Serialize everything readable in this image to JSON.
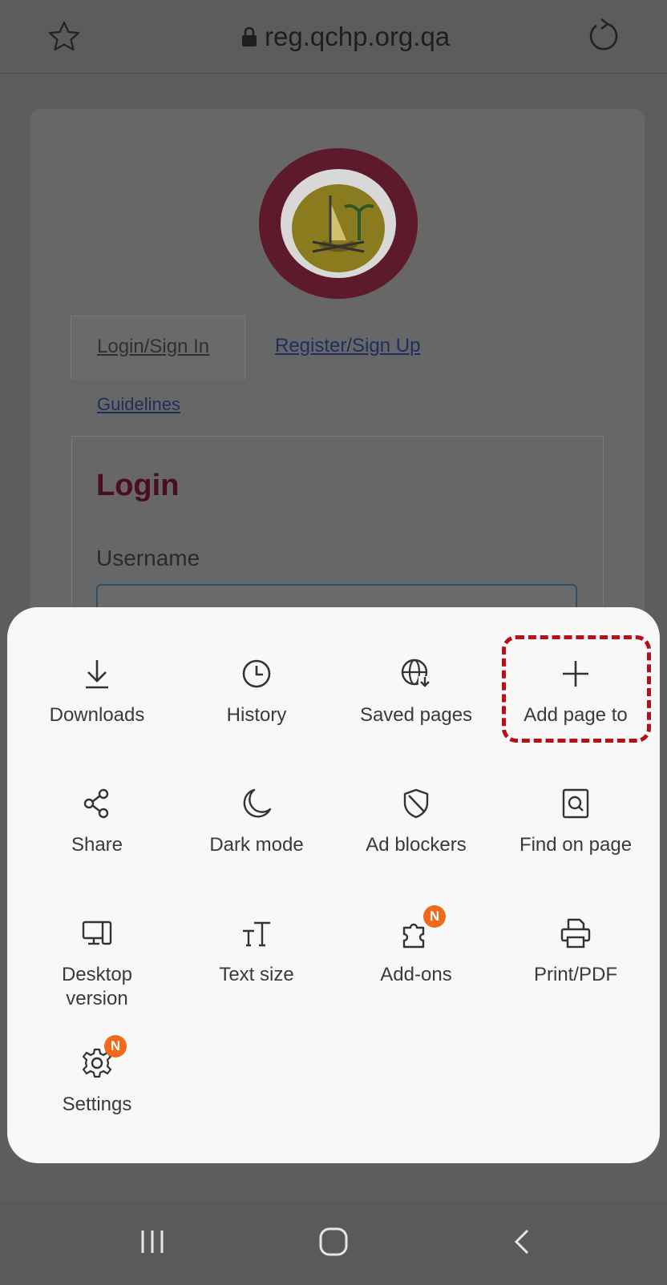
{
  "browser": {
    "url": "reg.qchp.org.qa",
    "icons": [
      "bookmark-star-icon",
      "lock-icon",
      "reload-icon"
    ]
  },
  "page": {
    "tabs": {
      "login": "Login/Sign In",
      "register": "Register/Sign Up",
      "guidelines": "Guidelines"
    },
    "login_title": "Login",
    "username_label": "Username",
    "username_placeholder": ""
  },
  "menu": {
    "items": [
      {
        "label": "Downloads",
        "icon": "download-icon"
      },
      {
        "label": "History",
        "icon": "clock-icon"
      },
      {
        "label": "Saved pages",
        "icon": "globe-download-icon"
      },
      {
        "label": "Add page to",
        "icon": "plus-icon"
      },
      {
        "label": "Share",
        "icon": "share-icon"
      },
      {
        "label": "Dark mode",
        "icon": "moon-icon"
      },
      {
        "label": "Ad blockers",
        "icon": "shield-icon"
      },
      {
        "label": "Find on page",
        "icon": "find-page-icon"
      },
      {
        "label": "Desktop\nversion",
        "icon": "desktop-icon"
      },
      {
        "label": "Text size",
        "icon": "text-size-icon"
      },
      {
        "label": "Add-ons",
        "icon": "puzzle-icon",
        "badge": "N"
      },
      {
        "label": "Print/PDF",
        "icon": "printer-icon"
      },
      {
        "label": "Settings",
        "icon": "gear-icon",
        "badge": "N"
      }
    ]
  },
  "colors": {
    "badge": "#f06a1c",
    "highlight": "#b3101a",
    "login_title": "#4a0e20"
  }
}
